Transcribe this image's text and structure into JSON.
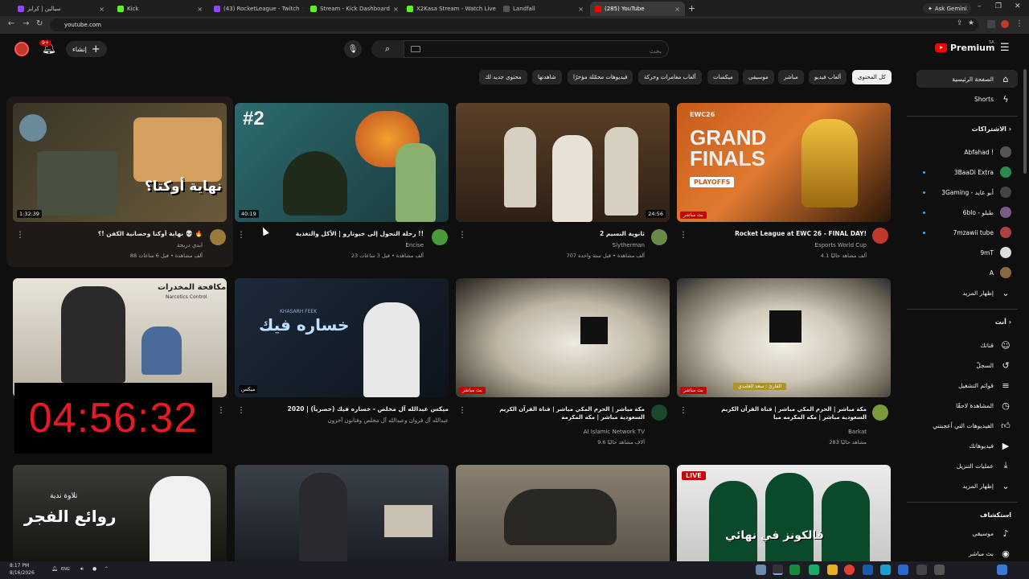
{
  "browser": {
    "tabs": [
      {
        "label": "سيالين | كرايز",
        "color": "#9146ff"
      },
      {
        "label": "Kick",
        "color": "#53fc18"
      },
      {
        "label": "(43) RocketLeague - Twitch",
        "color": "#9146ff"
      },
      {
        "label": "Stream - Kick Dashboard",
        "color": "#53fc18"
      },
      {
        "label": "X2Kasa Stream - Watch Live on",
        "color": "#53fc18"
      },
      {
        "label": "Landfall",
        "color": "#333333"
      },
      {
        "label": "(285) YouTube",
        "color": "#ff0000"
      }
    ],
    "new_tab": "+",
    "gemini": "Ask Gemini",
    "url": "youtube.com"
  },
  "header": {
    "create_label": "إنشاء",
    "search_placeholder": "بحث",
    "notif_count": "9+",
    "logo_text": "Premium",
    "logo_region": "SA"
  },
  "chips": [
    "كل المحتوى",
    "ألعاب فيديو",
    "مباشر",
    "موسيقى",
    "ميكسات",
    "ألعاب مغامرات وحركة",
    "فيديوهات محمّلة مؤخرًا",
    "شاهدتها",
    "محتوى جديد لك"
  ],
  "sidebar": {
    "main": [
      {
        "label": "الصفحة الرئيسية",
        "icon": "home-icon"
      },
      {
        "label": "Shorts",
        "icon": "shorts-icon"
      }
    ],
    "subs_title": "الاشتراكات",
    "subs": [
      {
        "label": "Abfahad !",
        "color": "#555555"
      },
      {
        "label": "3BaaDi Extra",
        "color": "#2d8a4e"
      },
      {
        "label": "3Gaming - أبو عايد",
        "color": "#444444"
      },
      {
        "label": "6blo - طبلو",
        "color": "#7a5a8a"
      },
      {
        "label": "7mzawii tube",
        "color": "#b04040"
      },
      {
        "label": "9mT",
        "color": "#dddddd"
      },
      {
        "label": "A",
        "color": "#8a6a3a"
      }
    ],
    "subs_more": "إظهار المزيد",
    "you_title": "أنت",
    "you": [
      {
        "label": "قناتك",
        "icon": "user-icon"
      },
      {
        "label": "السجلّ",
        "icon": "history-icon"
      },
      {
        "label": "قوائم التشغيل",
        "icon": "playlist-icon"
      },
      {
        "label": "المشاهدة لاحقًا",
        "icon": "clock-icon"
      },
      {
        "label": "الفيديوهات التي أعجبتني",
        "icon": "like-icon"
      },
      {
        "label": "فيديوهاتك",
        "icon": "video-icon"
      },
      {
        "label": "عمليات التنزيل",
        "icon": "download-icon"
      },
      {
        "label": "إظهار المزيد",
        "icon": "chevron-down-icon"
      }
    ],
    "explore_title": "استكشاف",
    "explore": [
      {
        "label": "موسيقى",
        "icon": "music-icon"
      },
      {
        "label": "بث مباشر",
        "icon": "live-icon"
      }
    ]
  },
  "videos": [
    {
      "title": "Rocket League at EWC 26 - FINAL DAY!",
      "channel": "Esports World Cup",
      "meta": "4.1 ألف مشاهد حاليًا",
      "badge": "بث مباشر",
      "thumb_text": "GRAND FINALS",
      "thumb_sub": "PLAYOFFS",
      "thumb_top": "EWC26"
    },
    {
      "title": "ثانوية النسيم 2",
      "channel": "Slytherman",
      "meta": "707 ألف مشاهدة • قبل سنة واحدة",
      "badge": "24:56"
    },
    {
      "title": "رحلة التحول إلى خيوتارو | الأكل والتغذية !!",
      "channel": "Encise",
      "meta": "23 ألف مشاهدة • قبل 3 ساعات",
      "badge": "40:19",
      "thumb_text": "#2"
    },
    {
      "title": "نهاية أوكتا وحصانية الكفن !؟ 💀 🔥",
      "channel": "ابدي دريحة",
      "meta": "88 ألف مشاهدة • قبل 6 ساعات",
      "badge": "1:32:39",
      "thumb_text": "نهاية أوكتا؟"
    },
    {
      "title": "مكة مباشر | الحرم المكي مباشر | قناة القرآن الكريم السعودية مباشر | مكه المكرمه مبا",
      "channel": "Barkat",
      "meta": "283 مشاهد حاليًا",
      "badge": "بث مباشر",
      "ribbon": "القارئ : سعد الغامدي"
    },
    {
      "title": "مكة مباشر | الحرم المكي مباشر | قناة القرآن الكريم السعودية مباشر | مكه المكرمة",
      "channel": "Al Islamic Network TV",
      "meta": "9.6 آلاف مشاهد حاليًا",
      "badge": "بث مباشر"
    },
    {
      "title": "ميكس عبدالله آل مخلص - خساره فيك (حصرياً) | 2020",
      "channel": "عبدالله آل فروان وعبدالله آل مخلص وفنانون آخرون",
      "meta": "",
      "badge": "ميكس",
      "thumb_text": "خساره فيك",
      "thumb_sub": "KHASARH FEEK"
    },
    {
      "title": "",
      "channel": "",
      "meta": "",
      "badge": "",
      "thumb_text": "مكافحة المخدرات",
      "thumb_sub": "Narcotics Control"
    },
    {
      "title": "",
      "channel": "",
      "meta": "",
      "badge": "LIVE",
      "thumb_text": "فالكونز في نهائي"
    },
    {
      "title": "",
      "channel": "",
      "meta": "",
      "badge": ""
    },
    {
      "title": "",
      "channel": "",
      "meta": "",
      "badge": ""
    },
    {
      "title": "",
      "channel": "",
      "meta": "",
      "badge": "",
      "thumb_text": "روائع الفجر",
      "thumb_sub": "تلاوة ندية"
    }
  ],
  "timer": "04:56:32",
  "taskbar": {
    "time": "8:17 PM",
    "date": "8/16/2026",
    "lang": "ENG"
  }
}
